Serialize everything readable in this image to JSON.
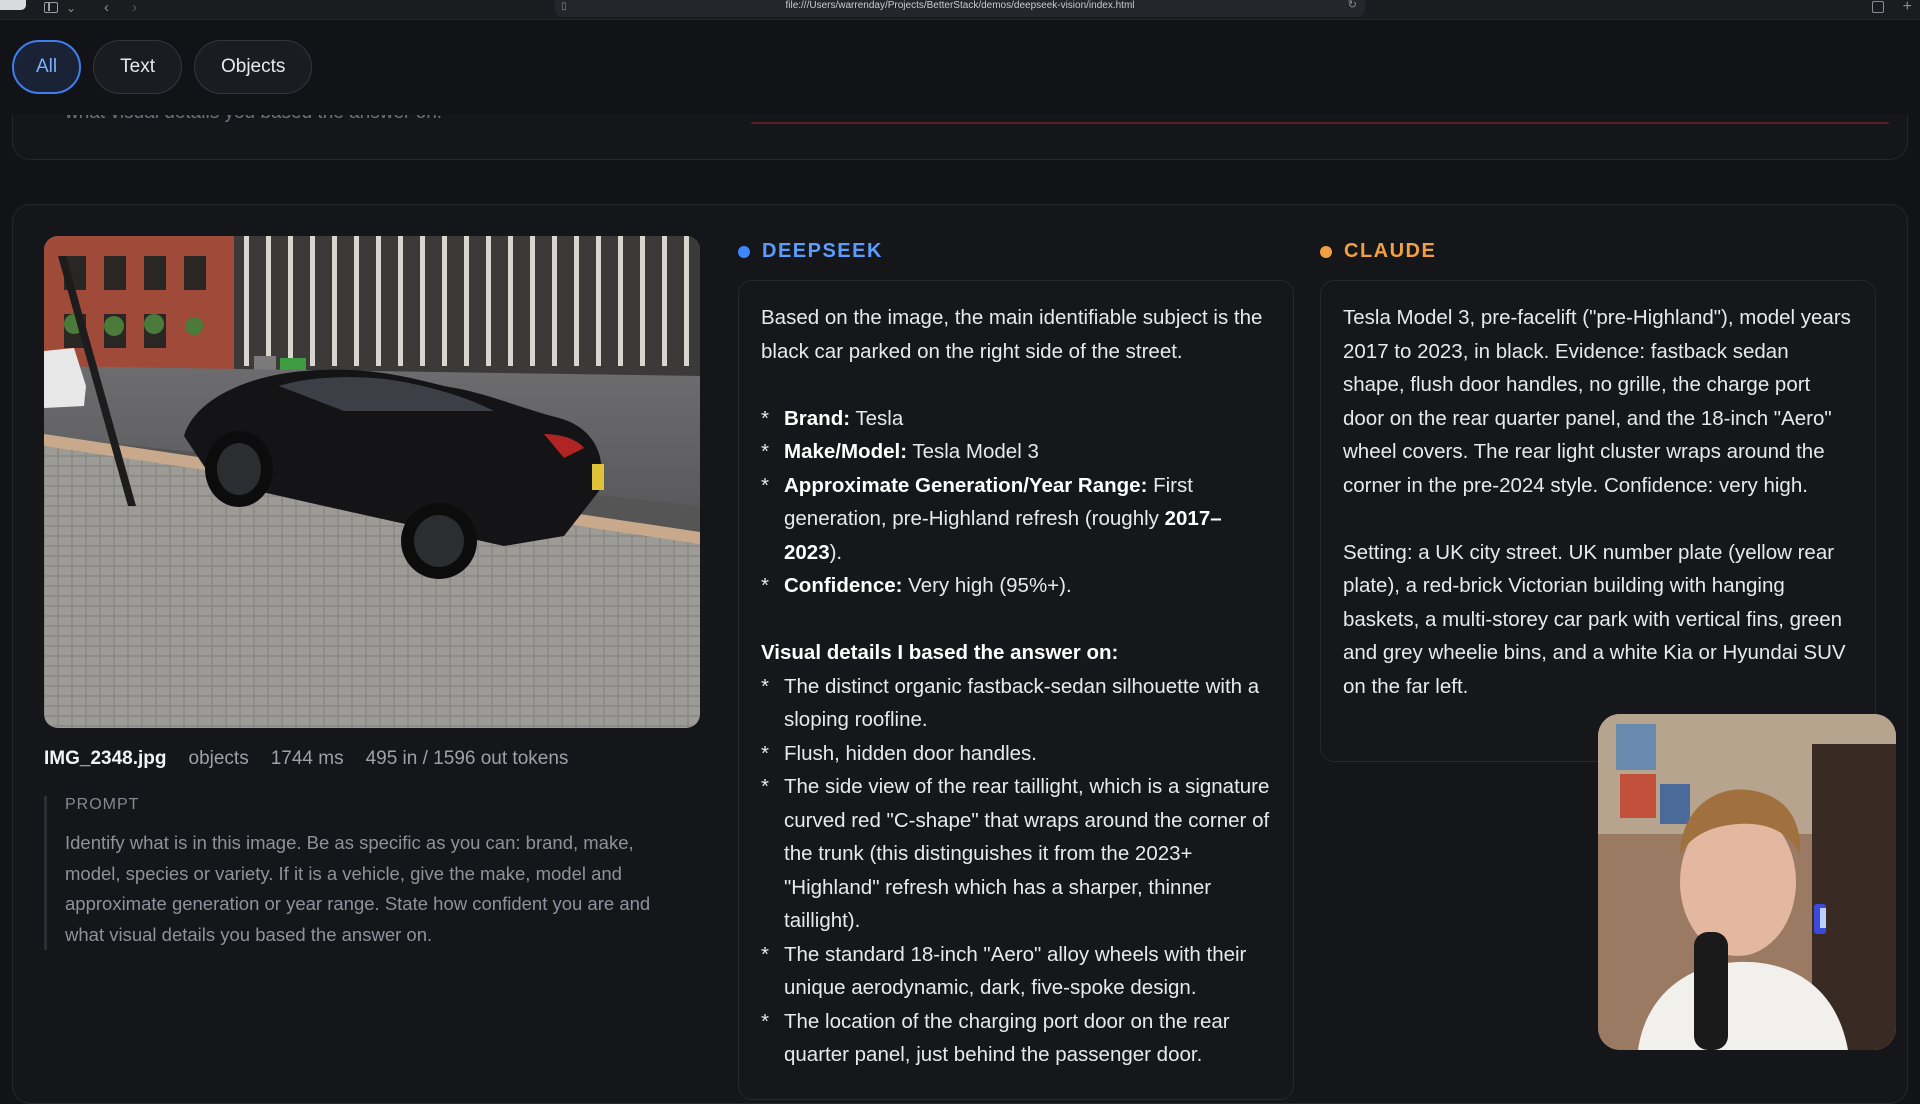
{
  "browser": {
    "url": "file:///Users/warrenday/Projects/BetterStack/demos/deepseek-vision/index.html"
  },
  "filters": [
    {
      "label": "All",
      "active": true
    },
    {
      "label": "Text",
      "active": false
    },
    {
      "label": "Objects",
      "active": false
    }
  ],
  "previous_card": {
    "text": "what visual details you based the answer on."
  },
  "result": {
    "filename": "IMG_2348.jpg",
    "category": "objects",
    "latency": "1744 ms",
    "tokens": "495 in / 1596 out tokens",
    "prompt_label": "PROMPT",
    "prompt_text": "Identify what is in this image. Be as specific as you can: brand, make, model, species or variety. If it is a vehicle, give the make, model and approximate generation or year range. State how confident you are and what visual details you based the answer on."
  },
  "deepseek": {
    "name": "DEEPSEEK",
    "intro": "Based on the image, the main identifiable subject is the black car parked on the right side of the street.",
    "bullets": [
      {
        "label": "Brand:",
        "text": " Tesla"
      },
      {
        "label": "Make/Model:",
        "text": " Tesla Model 3"
      },
      {
        "label": "Approximate Generation/Year Range:",
        "text": " First generation, pre-Highland refresh (roughly ",
        "bold_tail": "2017–2023",
        "after": ")."
      },
      {
        "label": "Confidence:",
        "text": " Very high (95%+)."
      }
    ],
    "details_heading": "Visual details I based the answer on:",
    "details": [
      "The distinct organic fastback-sedan silhouette with a sloping roofline.",
      "Flush, hidden door handles.",
      "The side view of the rear taillight, which is a signature curved red \"C-shape\" that wraps around the corner of the trunk (this distinguishes it from the 2023+ \"Highland\" refresh which has a sharper, thinner taillight).",
      "The standard 18-inch \"Aero\" alloy wheels with their unique aerodynamic, dark, five-spoke design.",
      "The location of the charging port door on the rear quarter panel, just behind the passenger door."
    ],
    "star": "*"
  },
  "claude": {
    "name": "CLAUDE",
    "para1": "Tesla Model 3, pre-facelift (\"pre-Highland\"), model years 2017 to 2023, in black. Evidence: fastback sedan shape, flush door handles, no grille, the charge port door on the rear quarter panel, and the 18-inch \"Aero\" wheel covers. The rear light cluster wraps around the corner in the pre-2024 style. Confidence: very high.",
    "para2": "Setting: a UK city street. UK number plate (yellow rear plate), a red-brick Victorian building with hanging baskets, a multi-storey car park with vertical fins, green and grey wheelie bins, and a white Kia or Hyundai SUV on the far left."
  },
  "colors": {
    "accent": "#3f7ef0",
    "deepseek": "#3f86ff",
    "claude": "#f0a040"
  }
}
